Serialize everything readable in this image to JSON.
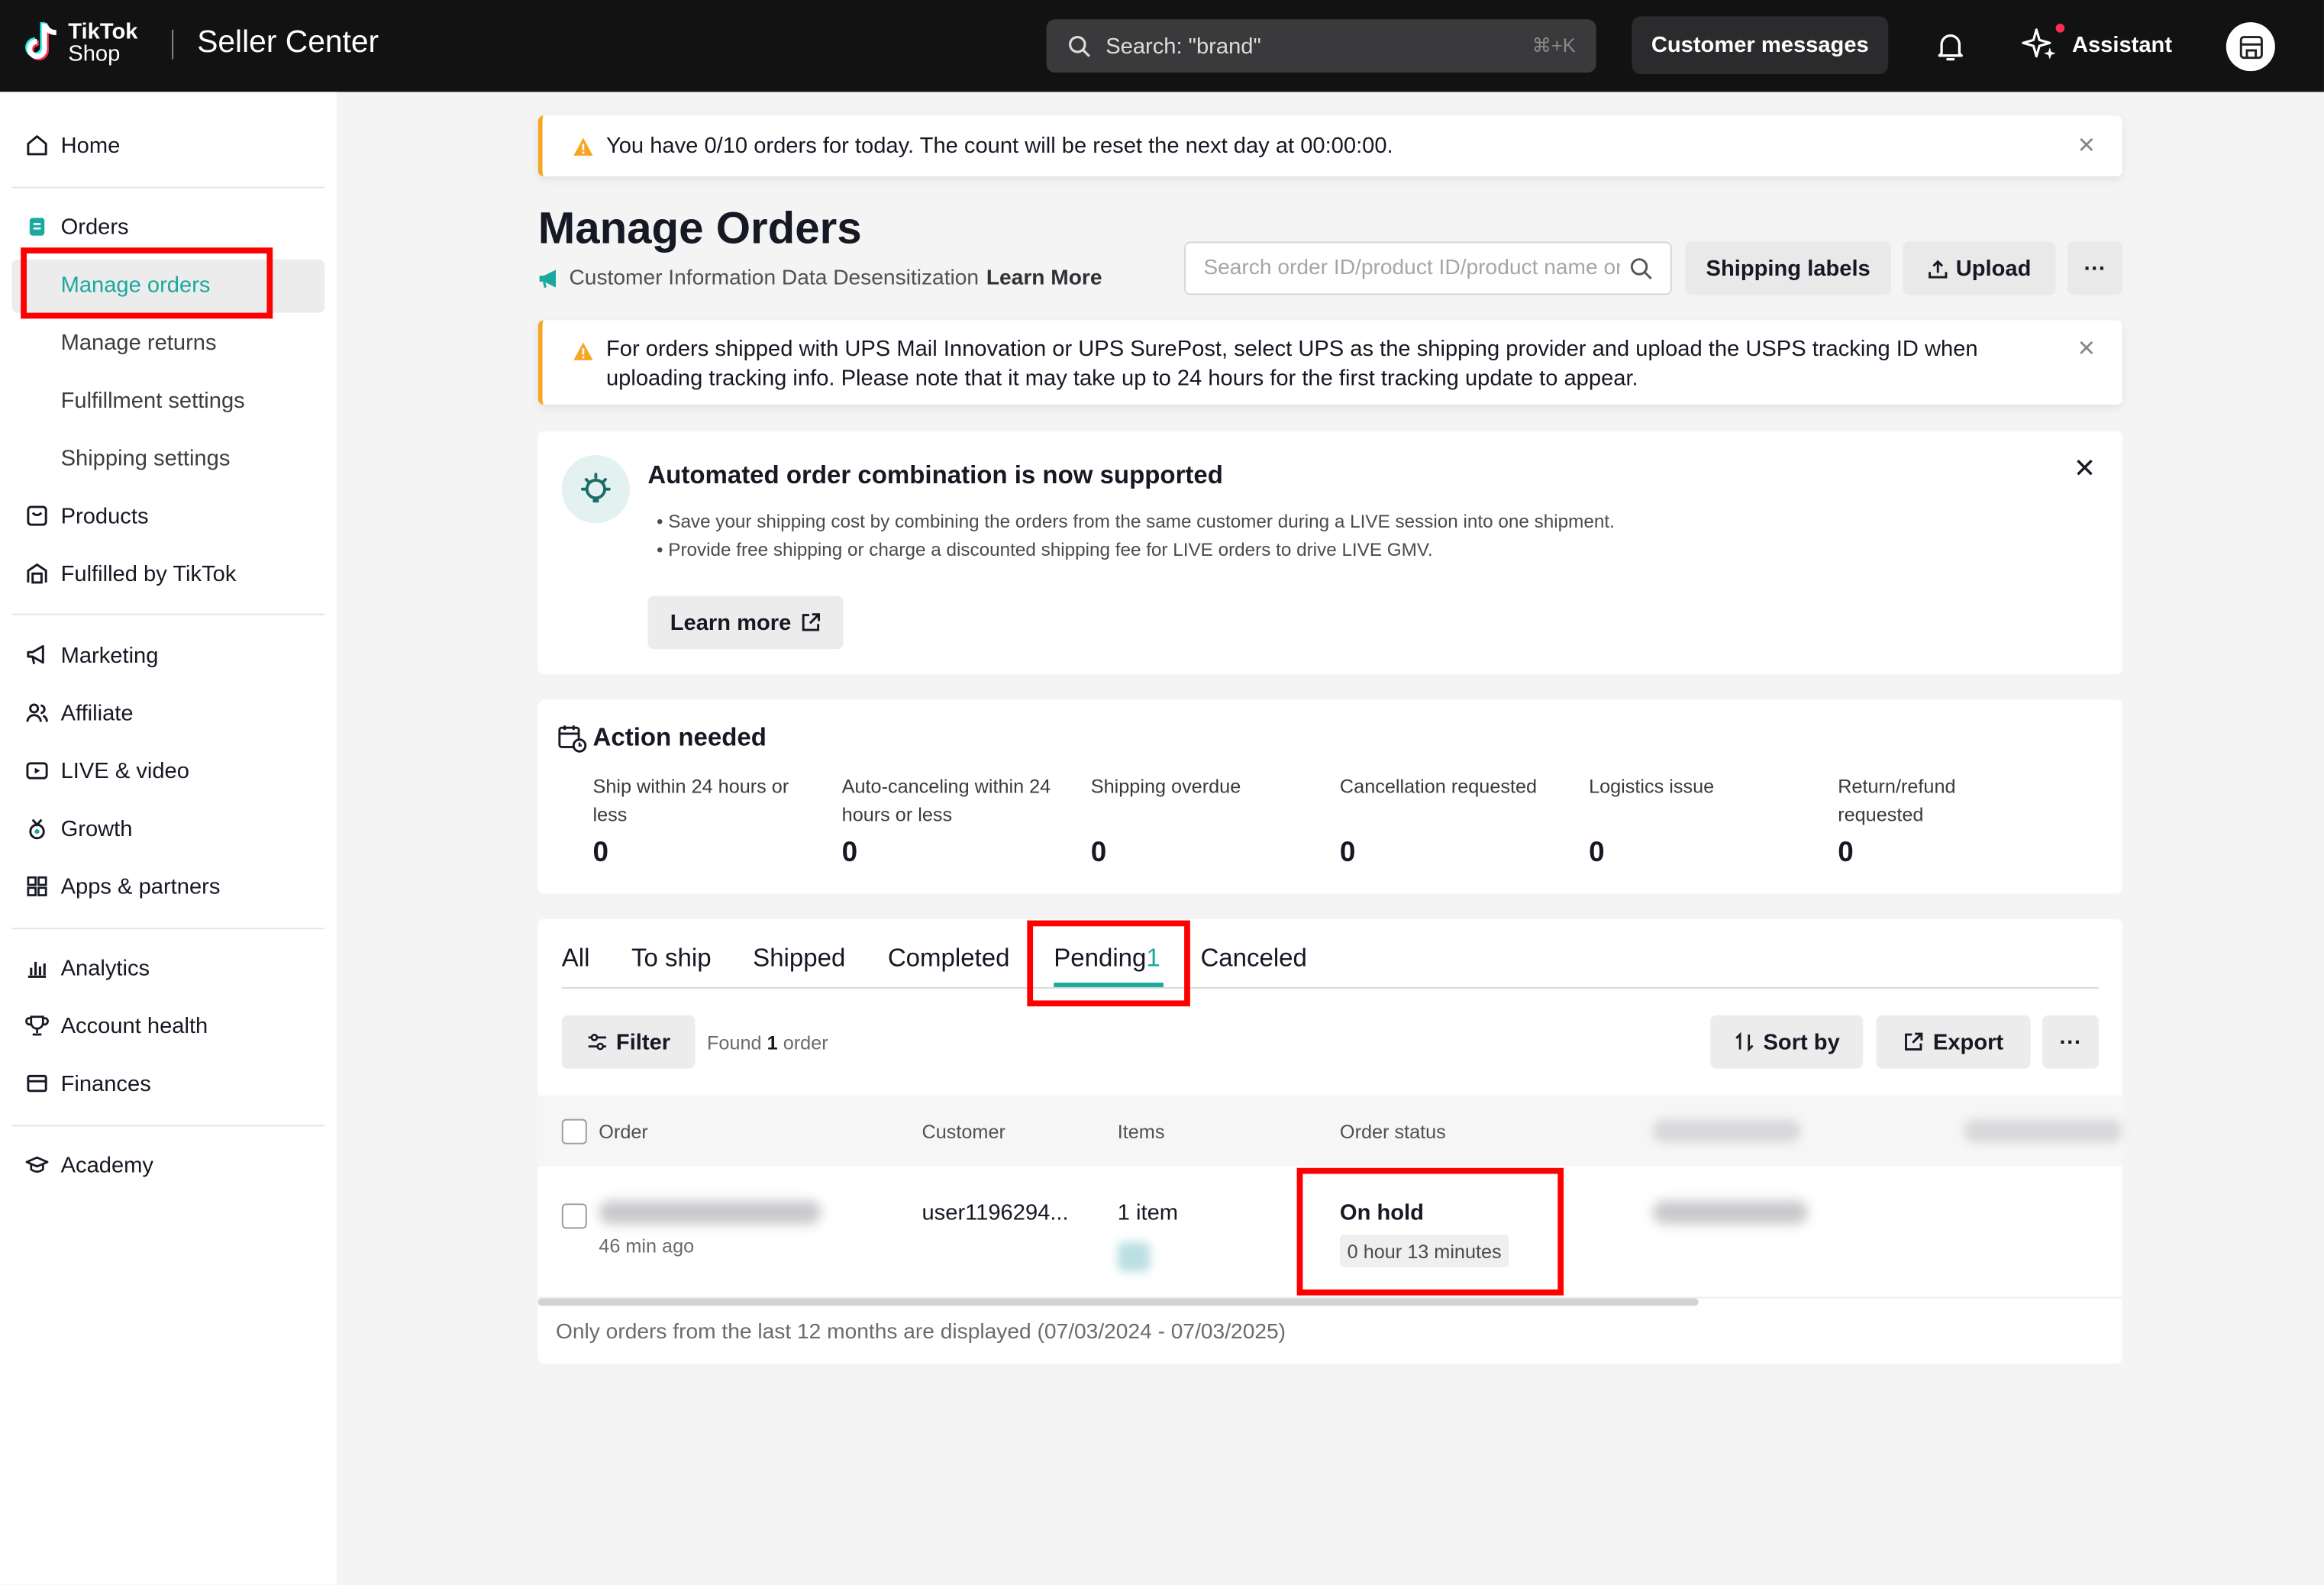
{
  "topbar": {
    "brand_top": "TikTok",
    "brand_bottom": "Shop",
    "app_name": "Seller Center",
    "search_placeholder": "Search: \"brand\"",
    "search_shortcut": "⌘+K",
    "customer_messages": "Customer messages",
    "assistant": "Assistant"
  },
  "sidebar": {
    "home": "Home",
    "orders": "Orders",
    "manage_orders": "Manage orders",
    "manage_returns": "Manage returns",
    "fulfillment_settings": "Fulfillment settings",
    "shipping_settings": "Shipping settings",
    "products": "Products",
    "fulfilled_by_tiktok": "Fulfilled by TikTok",
    "marketing": "Marketing",
    "affiliate": "Affiliate",
    "live_video": "LIVE & video",
    "growth": "Growth",
    "apps_partners": "Apps & partners",
    "analytics": "Analytics",
    "account_health": "Account health",
    "finances": "Finances",
    "academy": "Academy"
  },
  "top_banner": "You have 0/10 orders for today. The count will be reset the next day at 00:00:00.",
  "page": {
    "title": "Manage Orders",
    "desensitization": "Customer Information Data Desensitization",
    "learn_more": "Learn More",
    "order_search_placeholder": "Search order ID/product ID/product name or ID",
    "shipping_labels": "Shipping labels",
    "upload": "Upload",
    "more": "···"
  },
  "ups_banner": {
    "line1": "For orders shipped with UPS Mail Innovation or UPS SurePost, select UPS as the shipping provider and upload the USPS tracking ID when",
    "line2": "uploading tracking info. Please note that it may take up to 24 hours for the first tracking update to appear."
  },
  "combination_card": {
    "title": "Automated order combination is now supported",
    "bullet1": "Save your shipping cost by combining the orders from the same customer during a LIVE session into one shipment.",
    "bullet2": "Provide free shipping or charge a discounted shipping fee for LIVE orders to drive LIVE GMV.",
    "learn_more": "Learn more"
  },
  "action_needed": {
    "title": "Action needed",
    "metrics": [
      {
        "label": "Ship within 24 hours or less",
        "value": "0"
      },
      {
        "label": "Auto-canceling within 24 hours or less",
        "value": "0"
      },
      {
        "label": "Shipping overdue",
        "value": "0"
      },
      {
        "label": "Cancellation requested",
        "value": "0"
      },
      {
        "label": "Logistics issue",
        "value": "0"
      },
      {
        "label": "Return/refund requested",
        "value": "0"
      }
    ]
  },
  "tabs": {
    "all": "All",
    "to_ship": "To ship",
    "shipped": "Shipped",
    "completed": "Completed",
    "pending": "Pending",
    "pending_count": "1",
    "canceled": "Canceled"
  },
  "toolbar": {
    "filter": "Filter",
    "found_prefix": "Found",
    "found_count": "1",
    "found_suffix": "order",
    "sort_by": "Sort by",
    "export": "Export",
    "more": "···"
  },
  "table": {
    "headers": {
      "order": "Order",
      "customer": "Customer",
      "items": "Items",
      "order_status": "Order status"
    },
    "row": {
      "age": "46 min ago",
      "customer": "user1196294...",
      "items": "1 item",
      "status": "On hold",
      "status_timer": "0 hour 13 minutes"
    }
  },
  "footnote": "Only orders from the last 12 months are displayed (07/03/2024 - 07/03/2025)",
  "colors": {
    "accent": "#1aa99e",
    "highlight": "#ff0000",
    "warning": "#f5a623"
  }
}
